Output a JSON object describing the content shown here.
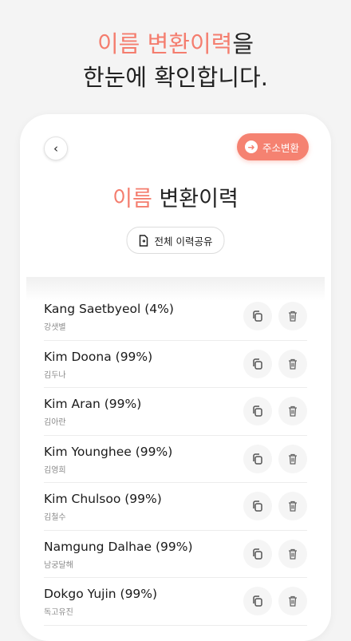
{
  "headline": {
    "line1_accent": "이름 변환이력",
    "line1_rest": "을",
    "line2": "한눈에 확인합니다."
  },
  "header": {
    "back_icon": "‹",
    "address_button_label": "주소변환",
    "address_button_icon": "➜"
  },
  "title": {
    "accent": "이름",
    "rest": " 변환이력"
  },
  "share_button_label": "전체 이력공유",
  "items": [
    {
      "name": "Kang Saetbyeol (4%)",
      "korean": "강샛별"
    },
    {
      "name": "Kim Doona (99%)",
      "korean": "김두나"
    },
    {
      "name": "Kim Aran (99%)",
      "korean": "김아란"
    },
    {
      "name": "Kim Younghee (99%)",
      "korean": "김영희"
    },
    {
      "name": "Kim Chulsoo (99%)",
      "korean": "김철수"
    },
    {
      "name": "Namgung Dalhae (99%)",
      "korean": "남궁달해"
    },
    {
      "name": "Dokgo Yujin (99%)",
      "korean": "독고유진"
    }
  ],
  "colors": {
    "accent": "#f47d6e",
    "button": "#f58271"
  }
}
